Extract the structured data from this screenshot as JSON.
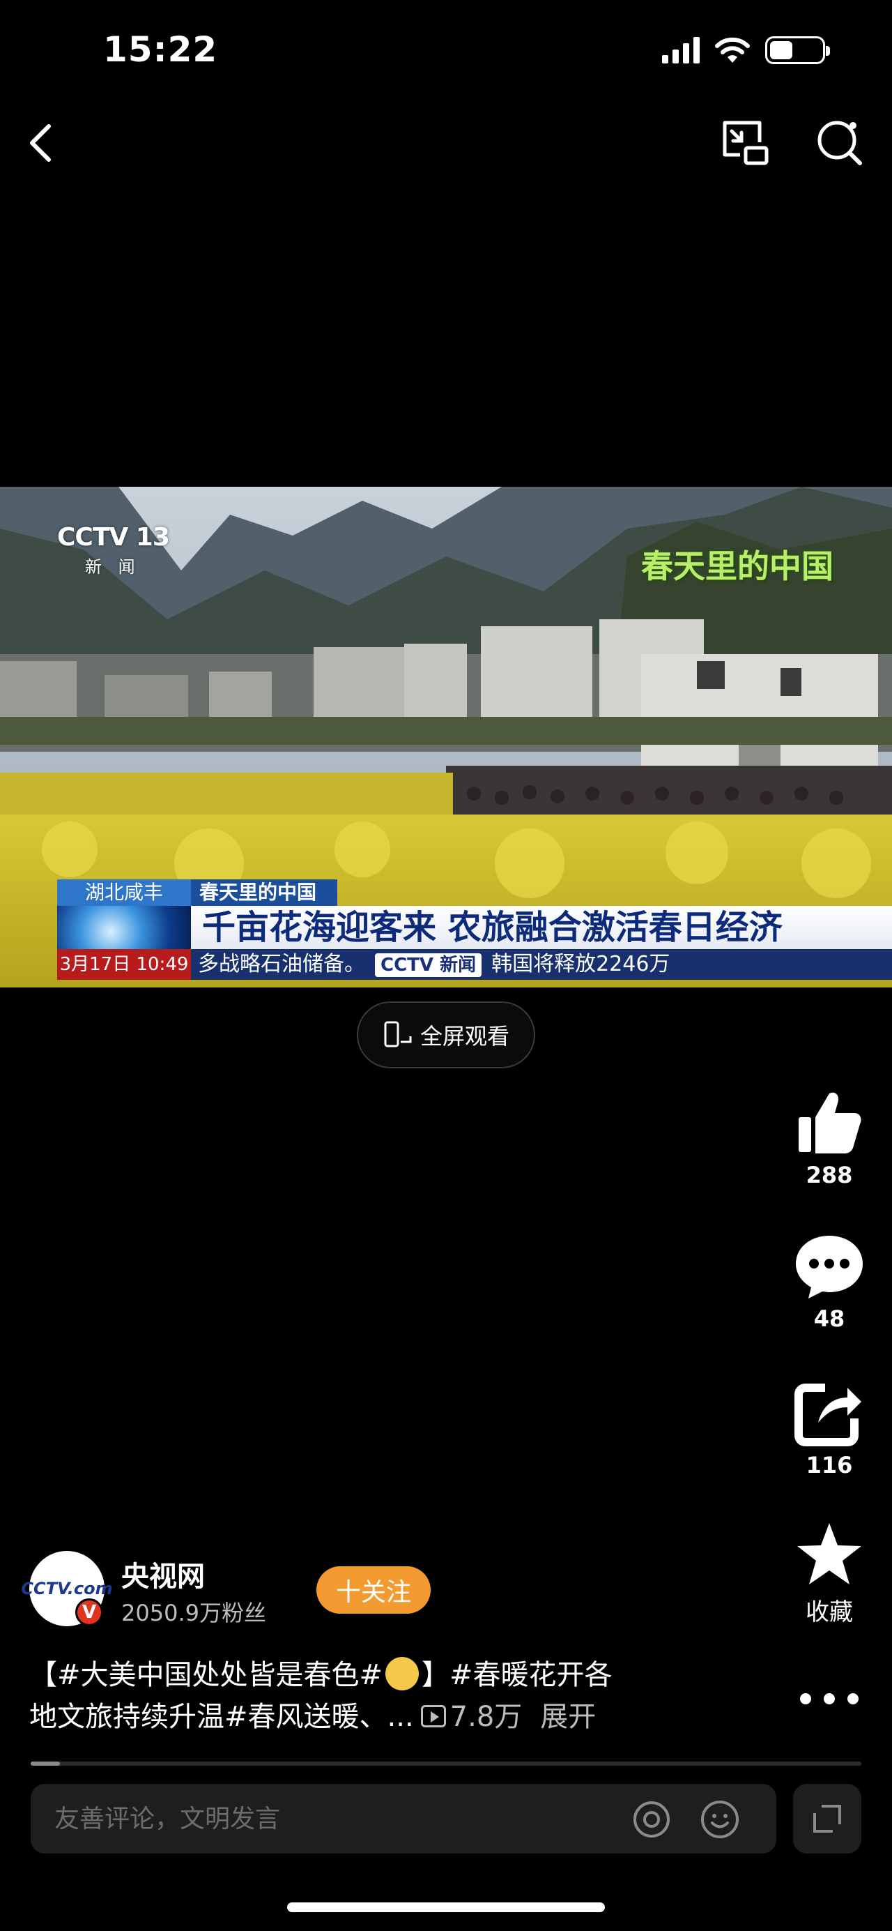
{
  "status_bar": {
    "time": "15:22"
  },
  "video": {
    "channel_logo": "CCTV 13",
    "channel_sub": "新 闻",
    "program_logo": "春天里的中国",
    "location_tag": "湖北咸丰",
    "topic_tag": "春天里的中国",
    "headline": "千亩花海迎客来 农旅融合激活春日经济",
    "time_tag": "3月17日 10:49",
    "ticker_left": "多战略石油储备。",
    "ticker_logo": "CCTV 新闻",
    "ticker_right": "韩国将释放2246万"
  },
  "fullscreen_label": "全屏观看",
  "actions": {
    "like_count": "288",
    "comment_count": "48",
    "share_count": "116",
    "favorite_label": "收藏"
  },
  "author": {
    "avatar_text": "CCTV.com",
    "verified_mark": "V",
    "name": "央视网",
    "fans": "2050.9万粉丝",
    "follow_label": "十关注"
  },
  "description": {
    "line1_a": "【#大美中国处处皆是春色#",
    "line1_b": "】#春暖花开各",
    "line2": "地文旅持续升温#春风送暖、...",
    "views": "7.8万",
    "expand": "展开"
  },
  "progress_fraction": 0.035,
  "comment_input": {
    "placeholder": "友善评论，文明发言"
  },
  "colors": {
    "follow_button": "#f39b30",
    "background": "#000000"
  }
}
